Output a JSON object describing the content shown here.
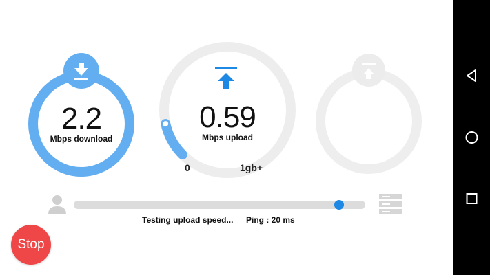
{
  "download": {
    "value": "2.2",
    "unit": "Mbps download",
    "icon": "download-arrow-icon"
  },
  "upload": {
    "value": "0.59",
    "unit": "Mbps upload",
    "icon": "upload-arrow-icon",
    "scale_min": "0",
    "scale_max": "1gb+",
    "gauge_progress": 0.12
  },
  "third_gauge": {
    "icon": "upload-arrow-icon",
    "state": "inactive"
  },
  "test": {
    "progress": 0.91,
    "status": "Testing upload speed...",
    "ping": "Ping : 20 ms"
  },
  "stop_button": {
    "label": "Stop"
  },
  "colors": {
    "accent": "#63aef0",
    "accent_dark": "#1e88e5",
    "ring_inactive": "#eeeeee",
    "stop": "#ef4747"
  },
  "navbar": {
    "buttons": [
      "back-icon",
      "home-icon",
      "recents-icon"
    ]
  }
}
